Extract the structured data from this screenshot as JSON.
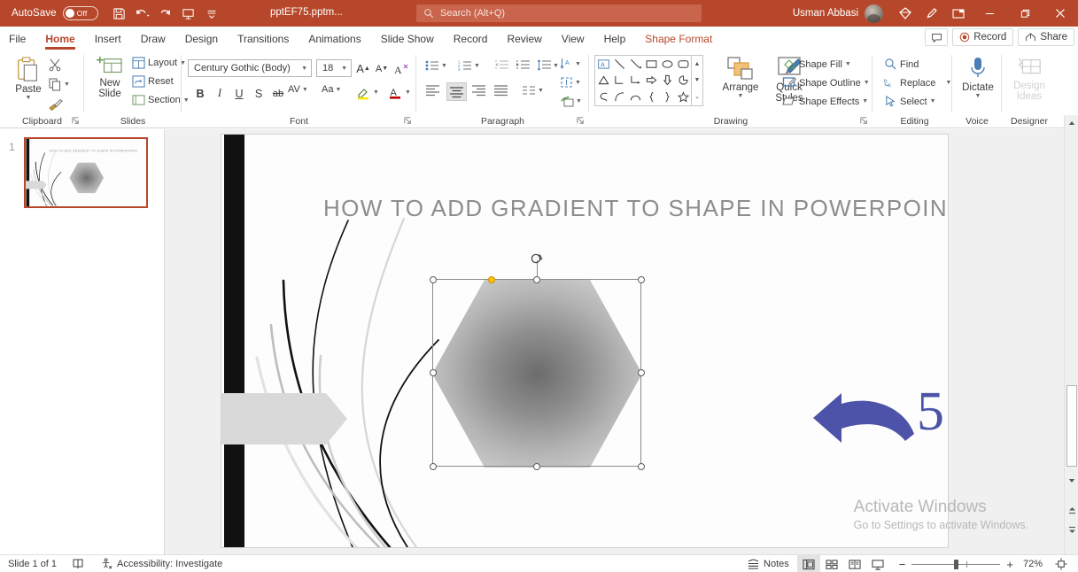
{
  "titlebar": {
    "autosave_label": "AutoSave",
    "autosave_state": "Off",
    "filename": "pptEF75.pptm...",
    "search_placeholder": "Search (Alt+Q)",
    "user_name": "Usman Abbasi",
    "qat": [
      "save-icon",
      "undo-icon",
      "redo-icon",
      "present-icon",
      "customize-qat-icon"
    ],
    "right_icons": [
      "diamond-icon",
      "pen-icon",
      "ribbon-display-options-icon"
    ],
    "window_buttons": [
      "minimize",
      "restore",
      "close"
    ]
  },
  "tabs": [
    {
      "label": "File",
      "active": false
    },
    {
      "label": "Home",
      "active": true
    },
    {
      "label": "Insert",
      "active": false
    },
    {
      "label": "Draw",
      "active": false
    },
    {
      "label": "Design",
      "active": false
    },
    {
      "label": "Transitions",
      "active": false
    },
    {
      "label": "Animations",
      "active": false
    },
    {
      "label": "Slide Show",
      "active": false
    },
    {
      "label": "Record",
      "active": false
    },
    {
      "label": "Review",
      "active": false
    },
    {
      "label": "View",
      "active": false
    },
    {
      "label": "Help",
      "active": false
    },
    {
      "label": "Shape Format",
      "active": false,
      "contextual": true
    }
  ],
  "tabbar_right": {
    "comments_icon": "comment-icon",
    "record_label": "Record",
    "share_label": "Share"
  },
  "ribbon": {
    "clipboard": {
      "title": "Clipboard",
      "paste_label": "Paste",
      "cut_icon": "scissors-icon",
      "copy_icon": "copy-icon",
      "format_painter_icon": "format-painter-icon"
    },
    "slides": {
      "title": "Slides",
      "new_slide_label": "New Slide",
      "layout_label": "Layout",
      "reset_label": "Reset",
      "section_label": "Section"
    },
    "font": {
      "title": "Font",
      "font_name": "Century Gothic (Body)",
      "font_size": "18",
      "grow_font": "A",
      "shrink_font": "A",
      "clear_formatting": "clear-formatting-icon",
      "bold": "B",
      "italic": "I",
      "underline": "U",
      "shadow": "S",
      "strikethrough": "ab",
      "character_spacing": "AV",
      "change_case": "Aa",
      "highlight_icon": "text-highlight-icon",
      "font_color_icon": "font-color-icon"
    },
    "paragraph": {
      "title": "Paragraph",
      "bullets_icon": "bullets-icon",
      "numbering_icon": "numbering-icon",
      "decrease_indent_icon": "decrease-indent-icon",
      "increase_indent_icon": "increase-indent-icon",
      "line_spacing_icon": "line-spacing-icon",
      "text_direction_icon": "text-direction-icon",
      "align_text_icon": "align-text-icon",
      "convert_smartart_icon": "convert-to-smartart-icon",
      "align_left_icon": "align-left-icon",
      "align_center_icon": "align-center-icon",
      "align_right_icon": "align-right-icon",
      "justify_icon": "justify-icon",
      "columns_icon": "columns-icon"
    },
    "drawing": {
      "title": "Drawing",
      "arrange_label": "Arrange",
      "quick_styles_label": "Quick Styles",
      "shape_fill_label": "Shape Fill",
      "shape_outline_label": "Shape Outline",
      "shape_effects_label": "Shape Effects"
    },
    "editing": {
      "title": "Editing",
      "find_label": "Find",
      "replace_label": "Replace",
      "select_label": "Select"
    },
    "voice": {
      "title": "Voice",
      "dictate_label": "Dictate"
    },
    "designer": {
      "title": "Designer",
      "design_ideas_label": "Design Ideas"
    }
  },
  "thumbnails": [
    {
      "number": "1",
      "selected": true
    }
  ],
  "slide": {
    "title": "HOW TO ADD GRADIENT TO SHAPE IN POWERPOINT",
    "shape": {
      "name": "hexagon",
      "selected": true,
      "fill": "radial-gradient-gray",
      "fill_center_color": "#6e6e6e",
      "fill_edge_color": "#c9c9c9"
    }
  },
  "annotation": {
    "arrow": "curved-left-arrow",
    "number": "5",
    "color": "#4d53a8"
  },
  "watermark": {
    "line1": "Activate Windows",
    "line2": "Go to Settings to activate Windows."
  },
  "statusbar": {
    "slide_count": "Slide 1 of 1",
    "language_icon": "language-icon",
    "accessibility": "Accessibility: Investigate",
    "notes_label": "Notes",
    "views": [
      "normal-view-icon",
      "slide-sorter-icon",
      "reading-view-icon",
      "slideshow-icon"
    ],
    "active_view": "normal-view-icon",
    "zoom_out": "−",
    "zoom_in": "+",
    "zoom_level": "72%",
    "fit_slide_icon": "fit-to-window-icon"
  },
  "colors": {
    "accent": "#b7472a",
    "titlebar": "#b7472a",
    "annotation": "#4d53a8"
  }
}
